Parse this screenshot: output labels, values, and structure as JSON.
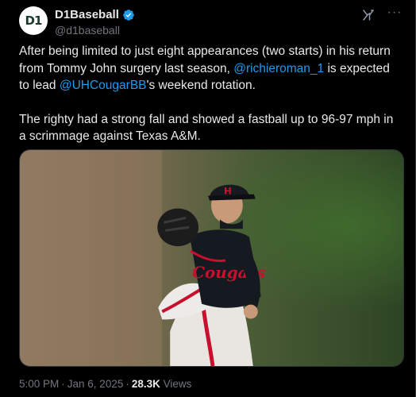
{
  "author": {
    "display_name": "D1Baseball",
    "handle": "@d1baseball",
    "avatar_text": "D1",
    "verified": true
  },
  "tweet": {
    "paragraph1": {
      "text_before": "After being limited to just eight appearances (two starts) in his return from Tommy John surgery last season, ",
      "mention1": "@richieroman_1",
      "text_middle": " is expected to lead ",
      "mention2": "@UHCougarBB",
      "text_after": "'s weekend rotation."
    },
    "paragraph2": "The righty had a strong fall and showed a fastball up to 96-97 mph in a scrimmage against Texas A&M."
  },
  "media": {
    "jersey_text": "Cougars"
  },
  "meta": {
    "time": "5:00 PM",
    "separator": "·",
    "date": "Jan 6, 2025",
    "views_count": "28.3K",
    "views_label": "Views"
  },
  "icons": {
    "verified": "verified-badge-icon",
    "grok": "grok-icon",
    "more": "more-options-icon"
  },
  "colors": {
    "background": "#000000",
    "text": "#e7e9ea",
    "muted": "#71767b",
    "link": "#1d9bf0"
  }
}
